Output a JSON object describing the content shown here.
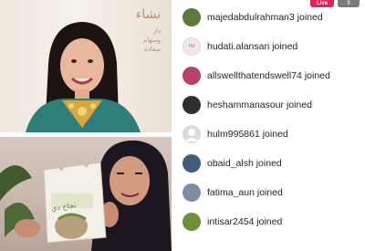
{
  "video": {
    "sign_text": "نشاء",
    "sign_subtext": "دار\nوسهام\nسعادة"
  },
  "product": {
    "box_label": "نجاح دي"
  },
  "badges": {
    "live": "Live",
    "viewers": "9"
  },
  "comments": [
    {
      "user": "majedabdulrahman3",
      "action": "joined",
      "avatar_color": "#5b7a3c"
    },
    {
      "user": "hudati.alansari",
      "action": "joined",
      "avatar_color": "#f3e7ea"
    },
    {
      "user": "allswellthatendswell74",
      "action": "joined",
      "avatar_color": "#b4426a"
    },
    {
      "user": "heshammanasour",
      "action": "joined",
      "avatar_color": "#2f2f2f"
    },
    {
      "user": "hulm995861",
      "action": "joined",
      "avatar_color": "#dbdbdb"
    },
    {
      "user": "obaid_alsh",
      "action": "joined",
      "avatar_color": "#3f5d7a"
    },
    {
      "user": "fatima_aun",
      "action": "joined",
      "avatar_color": "#7d8ea3"
    },
    {
      "user": "intisar2454",
      "action": "joined",
      "avatar_color": "#6c8f3a"
    }
  ]
}
